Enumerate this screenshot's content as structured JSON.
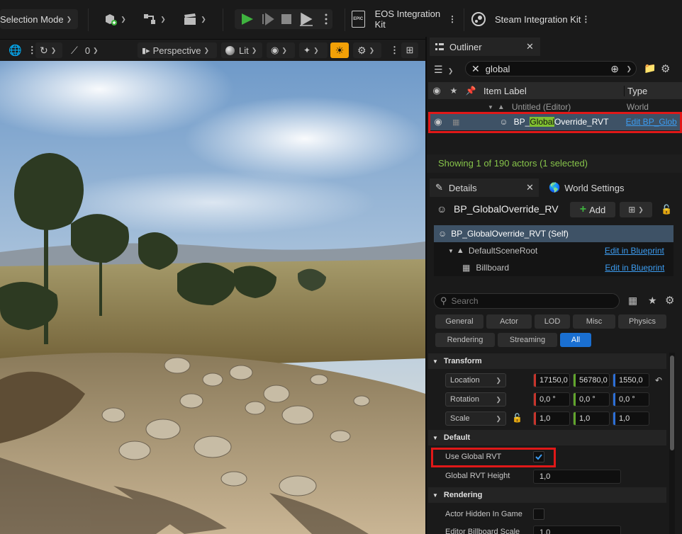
{
  "toolbar": {
    "selection_mode": "Selection Mode",
    "eos_label": "EOS Integration Kit",
    "steam_label": "Steam Integration Kit",
    "epic_badge": "EPIC"
  },
  "viewport": {
    "snap_value": "0",
    "perspective": "Perspective",
    "lit": "Lit"
  },
  "outliner": {
    "tab_label": "Outliner",
    "search_value": "global",
    "col_item_label": "Item Label",
    "col_type": "Type",
    "world_row": {
      "label": "Untitled (Editor)",
      "type": "World"
    },
    "actor_row": {
      "label_prefix": "BP_",
      "label_highlight": "Global",
      "label_suffix": "Override_RVT",
      "type": "Edit BP_Glob"
    },
    "status": "Showing 1 of 190 actors (1 selected)"
  },
  "details": {
    "tab_label": "Details",
    "world_settings_tab": "World Settings",
    "actor_name": "BP_GlobalOverride_RV",
    "add_label": "Add",
    "components": [
      {
        "label": "BP_GlobalOverride_RVT (Self)",
        "link": ""
      },
      {
        "label": "DefaultSceneRoot",
        "link": "Edit in Blueprint"
      },
      {
        "label": "Billboard",
        "link": "Edit in Blueprint"
      }
    ],
    "search_placeholder": "Search",
    "filters_row1": [
      "General",
      "Actor",
      "LOD",
      "Misc",
      "Physics"
    ],
    "filters_row2": [
      "Rendering",
      "Streaming",
      "All"
    ],
    "sections": {
      "transform": "Transform",
      "default": "Default",
      "rendering": "Rendering"
    },
    "transform": {
      "location": {
        "label": "Location",
        "x": "17150,0",
        "y": "56780,0",
        "z": "1550,0"
      },
      "rotation": {
        "label": "Rotation",
        "x": "0,0 °",
        "y": "0,0 °",
        "z": "0,0 °"
      },
      "scale": {
        "label": "Scale",
        "x": "1,0",
        "y": "1,0",
        "z": "1,0"
      }
    },
    "default": {
      "use_global_rvt": {
        "label": "Use Global RVT",
        "checked": true
      },
      "global_rvt_height": {
        "label": "Global RVT Height",
        "value": "1,0"
      }
    },
    "rendering": {
      "actor_hidden": {
        "label": "Actor Hidden In Game",
        "checked": false
      },
      "billboard_scale": {
        "label": "Editor Billboard Scale",
        "value": "1,0"
      }
    }
  },
  "colors": {
    "accent_blue": "#1a6fd1",
    "play_green": "#3fb33f",
    "status_green": "#86c34a",
    "highlight": "#80c030",
    "red_marker": "#e01818",
    "sun_badge": "#f2a007"
  }
}
